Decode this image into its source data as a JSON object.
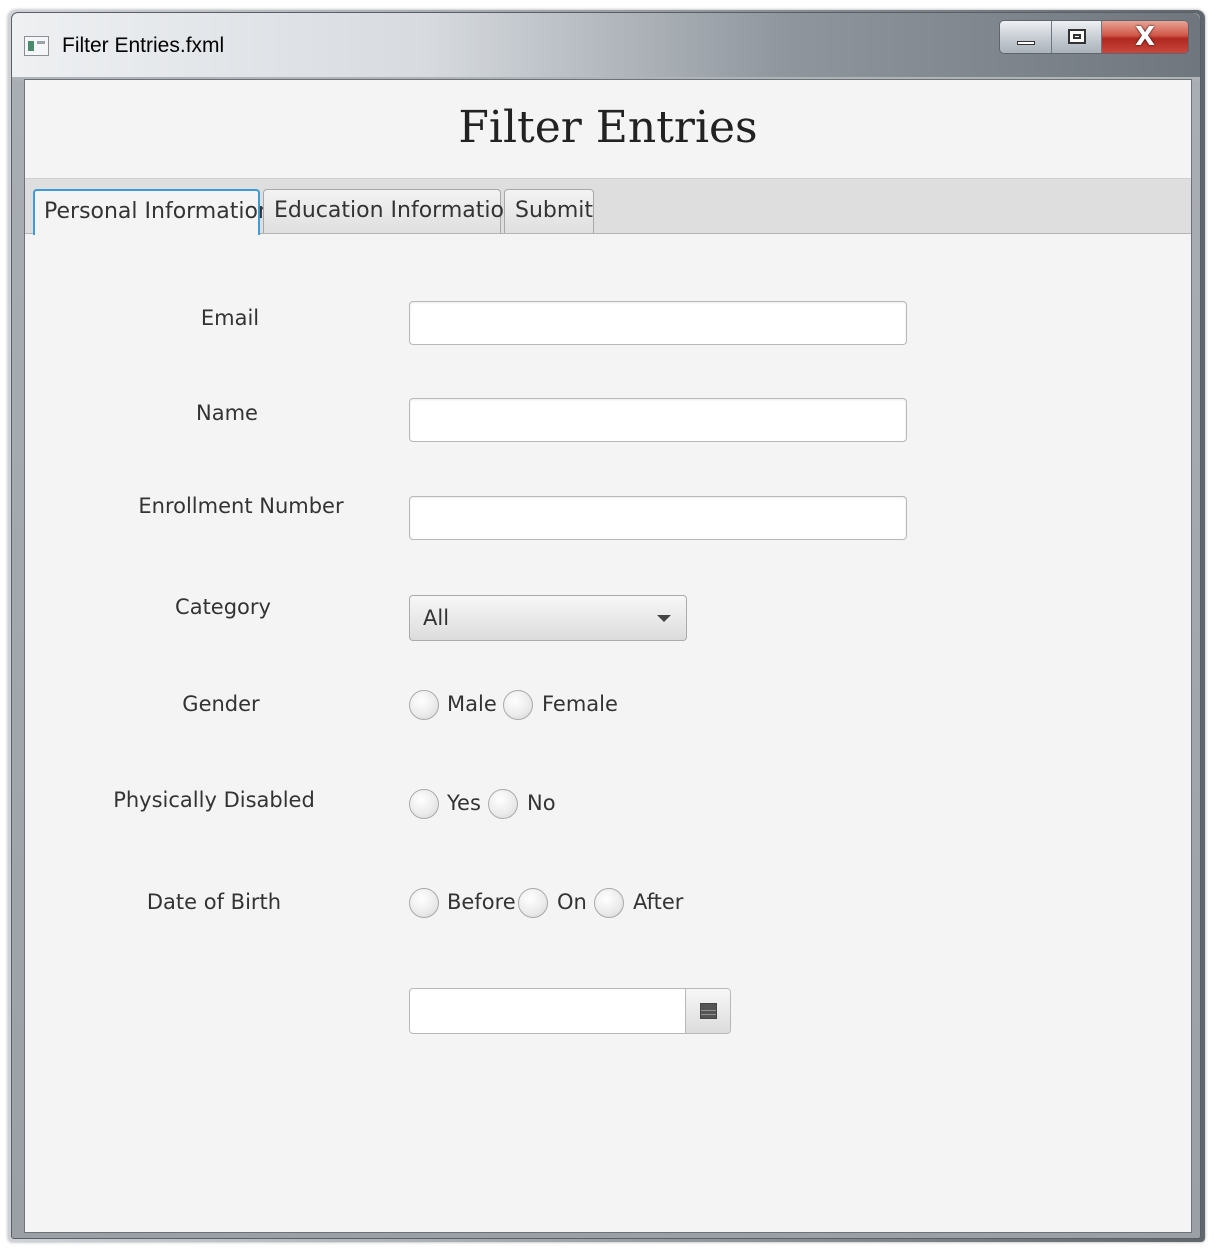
{
  "window": {
    "title": "Filter Entries.fxml",
    "icon": "java-app-icon",
    "controls": {
      "minimize": "minimize-icon",
      "maximize": "maximize-icon",
      "close": "X"
    }
  },
  "heading": "Filter Entries",
  "tabs": [
    {
      "label": "Personal Information",
      "active": true
    },
    {
      "label": "Education Information",
      "active": false
    },
    {
      "label": "Submit",
      "active": false
    }
  ],
  "form": {
    "email": {
      "label": "Email",
      "value": ""
    },
    "name": {
      "label": "Name",
      "value": ""
    },
    "enrollment": {
      "label": "Enrollment Number",
      "value": ""
    },
    "category": {
      "label": "Category",
      "value": "All"
    },
    "gender": {
      "label": "Gender",
      "options": [
        "Male",
        "Female"
      ]
    },
    "disabled": {
      "label": "Physically Disabled",
      "options": [
        "Yes",
        "No"
      ]
    },
    "dob": {
      "label": "Date of Birth",
      "options": [
        "Before",
        "On",
        "After"
      ],
      "date_value": ""
    }
  },
  "colors": {
    "tab_focus": "#3d9bd5",
    "background": "#f4f4f4"
  }
}
